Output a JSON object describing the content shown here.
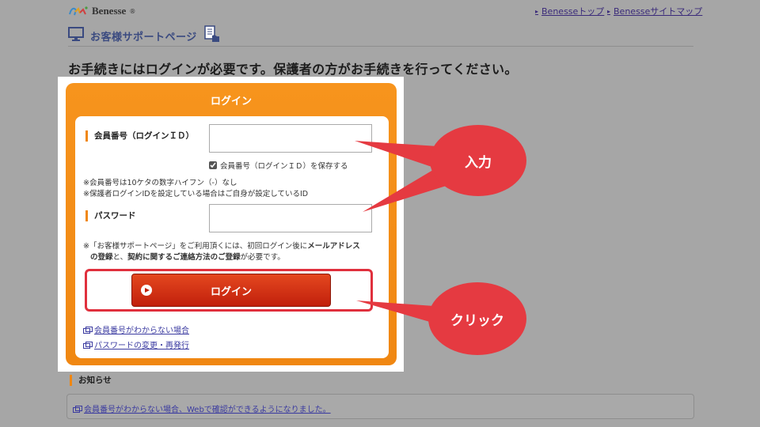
{
  "header": {
    "logo_text": "Benesse",
    "logo_mark": "®",
    "links": [
      "Benesseトップ",
      "Benesseサイトマップ"
    ],
    "support_title": "お客様サポートページ",
    "icons": [
      "monitor-icon",
      "document-hand-icon"
    ]
  },
  "headline": "お手続きにはログインが必要です。保護者の方がお手続きを行ってください。",
  "login": {
    "title": "ログイン",
    "member_label": "会員番号（ログインＩＤ）",
    "member_value": "",
    "save_label": "会員番号（ログインＩＤ）を保存する",
    "save_checked": true,
    "notes": [
      "※会員番号は10ケタの数字ハイフン（-）なし",
      "※保護者ログインIDを設定している場合はご自身が設定しているID"
    ],
    "password_label": "パスワード",
    "password_value": "",
    "info_prefix": "※「お客様サポートページ」をご利用頂くには、初回ログイン後に",
    "info_bold_1": "メールアドレス",
    "info_bold_2": "の登録",
    "info_mid": "と、",
    "info_bold_3": "契約に関するご連絡方法のご登録",
    "info_suffix": "が必要です。",
    "button_label": "ログイン",
    "links": [
      "会員番号がわからない場合",
      "パスワードの変更・再発行"
    ]
  },
  "news": {
    "label": "お知らせ",
    "item": "会員番号がわからない場合、Webで確認ができるようになりました。"
  },
  "callouts": {
    "input": "入力",
    "click": "クリック"
  },
  "colors": {
    "overlay": "#a6a6a6",
    "card_orange": "#f7941d",
    "button_red": "#c1200c",
    "callout_red": "#e53a41"
  }
}
